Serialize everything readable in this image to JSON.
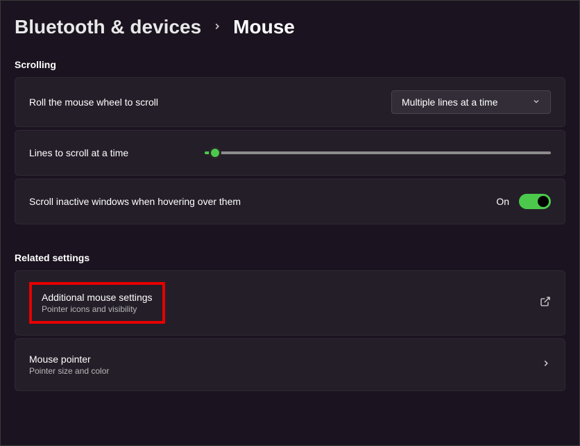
{
  "breadcrumb": {
    "parent": "Bluetooth & devices",
    "current": "Mouse"
  },
  "sections": {
    "scrolling": {
      "header": "Scrolling",
      "roll_label": "Roll the mouse wheel to scroll",
      "roll_value": "Multiple lines at a time",
      "lines_label": "Lines to scroll at a time",
      "inactive_label": "Scroll inactive windows when hovering over them",
      "inactive_state": "On"
    },
    "related": {
      "header": "Related settings",
      "additional": {
        "title": "Additional mouse settings",
        "sub": "Pointer icons and visibility"
      },
      "pointer": {
        "title": "Mouse pointer",
        "sub": "Pointer size and color"
      }
    }
  }
}
